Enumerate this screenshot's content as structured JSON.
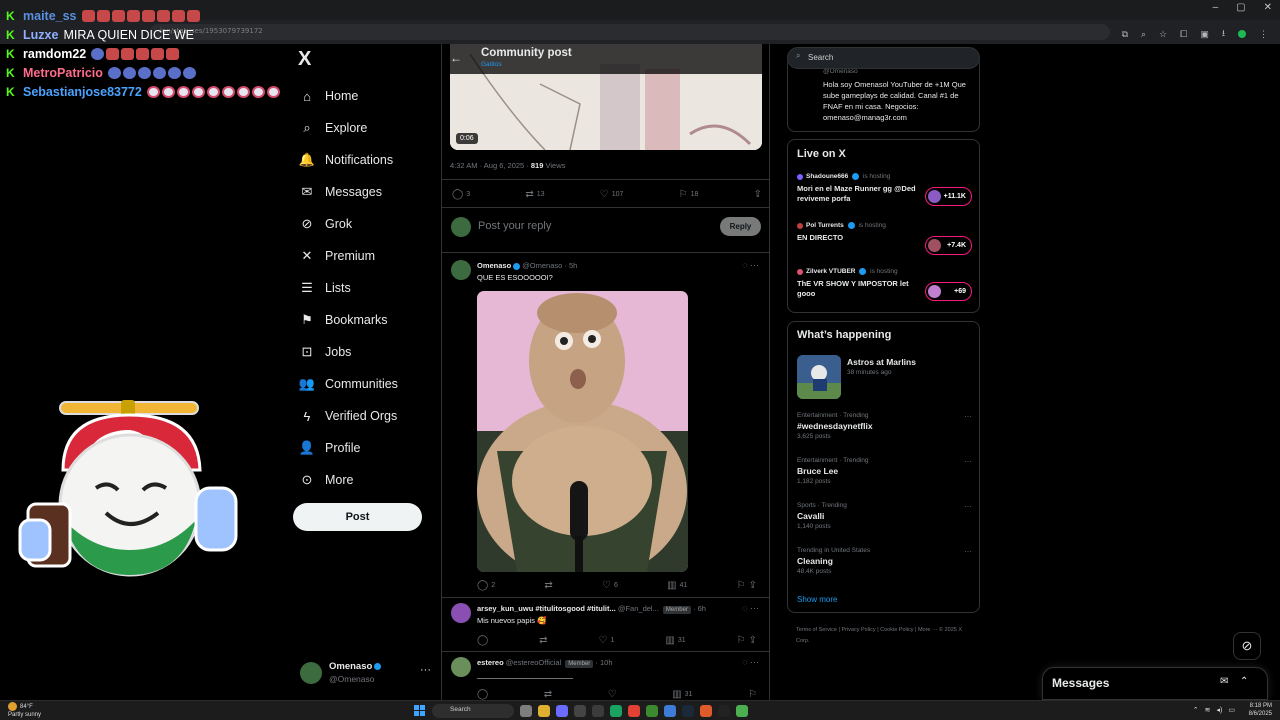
{
  "browser": {
    "address": "ion/statuses/1953079739172",
    "window_controls": [
      "–",
      "▢",
      "✕"
    ],
    "ext_icons": [
      "⧉",
      "⌕",
      "☆",
      "⧠",
      "▣",
      "⭳",
      "⋮"
    ]
  },
  "stream_chat": [
    {
      "name": "maite_ss",
      "name_color": "#5b8fe0",
      "message": "",
      "emotes": [
        "red",
        "red",
        "red",
        "red",
        "red",
        "red",
        "red",
        "red"
      ]
    },
    {
      "name": "Luzxe",
      "name_color": "#8fb0ff",
      "message": "MIRA QUIEN DICE WE",
      "emotes": []
    },
    {
      "name": "ramdom22",
      "name_color": "#ffffff",
      "message": "",
      "emotes": [
        "blue",
        "red",
        "red",
        "red",
        "red",
        "red"
      ]
    },
    {
      "name": "MetroPatricio",
      "name_color": "#ff6b8b",
      "message": "",
      "emotes": [
        "blue",
        "blue",
        "blue",
        "blue",
        "blue",
        "blue"
      ]
    },
    {
      "name": "Sebastianjose83772",
      "name_color": "#4aa3ff",
      "message": "",
      "emotes": [
        "pink",
        "pink",
        "pink",
        "pink",
        "pink",
        "pink",
        "pink",
        "pink",
        "pink"
      ]
    }
  ],
  "nav": {
    "logo": "X",
    "items": [
      {
        "label": "Home",
        "icon": "home-icon",
        "glyph": "⌂"
      },
      {
        "label": "Explore",
        "icon": "search-icon",
        "glyph": "⌕"
      },
      {
        "label": "Notifications",
        "icon": "bell-icon",
        "glyph": "🔔"
      },
      {
        "label": "Messages",
        "icon": "envelope-icon",
        "glyph": "✉"
      },
      {
        "label": "Grok",
        "icon": "grok-icon",
        "glyph": "⊘"
      },
      {
        "label": "Premium",
        "icon": "x-icon",
        "glyph": "✕"
      },
      {
        "label": "Lists",
        "icon": "list-icon",
        "glyph": "☰"
      },
      {
        "label": "Bookmarks",
        "icon": "bookmark-icon",
        "glyph": "⚑"
      },
      {
        "label": "Jobs",
        "icon": "briefcase-icon",
        "glyph": "⊡"
      },
      {
        "label": "Communities",
        "icon": "people-icon",
        "glyph": "👥"
      },
      {
        "label": "Verified Orgs",
        "icon": "lightning-icon",
        "glyph": "ϟ"
      },
      {
        "label": "Profile",
        "icon": "person-icon",
        "glyph": "👤"
      },
      {
        "label": "More",
        "icon": "more-circle-icon",
        "glyph": "⊙"
      }
    ],
    "post_button": "Post",
    "account": {
      "name": "Omenaso",
      "handle": "@Omenaso",
      "more": "···"
    }
  },
  "header": {
    "title": "Community post",
    "subtitle": "Gatitos",
    "back": "←"
  },
  "main_post": {
    "video_time": "0:06",
    "timestamp": "4:32 AM · Aug 6, 2025 · ",
    "views_count": "819",
    "views_label": " Views",
    "stats": {
      "replies": "3",
      "reposts": "13",
      "likes": "107",
      "bookmarks": "18"
    }
  },
  "reply_box": {
    "placeholder": "Post your reply",
    "button": "Reply"
  },
  "replies": [
    {
      "name": "Omenaso",
      "handle": "@Omenaso · 5h",
      "text": "QUE ES ESOOOOOI?",
      "stats": {
        "replies": "2",
        "reposts": "",
        "likes": "6",
        "views": "41"
      }
    },
    {
      "name": "arsey_kun_uwu #titulitosgood #titulit...",
      "handle": "@Fan_del...",
      "badge": "Member",
      "time": "· 6h",
      "text": "Mis nuevos papis 🥰",
      "stats": {
        "replies": "",
        "reposts": "",
        "likes": "1",
        "views": "31"
      }
    },
    {
      "name": "estereo",
      "handle": "@estereoOfficial",
      "badge": "Member",
      "time": "· 10h",
      "text": "_______________________",
      "stats": {
        "replies": "",
        "reposts": "",
        "likes": "",
        "views": "31"
      }
    }
  ],
  "sidebar": {
    "search_placeholder": "Search",
    "bio": {
      "handle": "@Omenaso",
      "text": "Hola soy Omenasol YouTuber de +1M Que sube gameplays de calidad. Canal #1 de FNAF en mi casa. Negocios: omenaso@manag3r.com"
    },
    "live": {
      "title": "Live on X",
      "items": [
        {
          "host": "Shadoune666",
          "hosting": "is hosting",
          "title": "Mori en el Maze Runner gg @Ded reviveme porfa",
          "count": "+11.1K"
        },
        {
          "host": "Pol Turrents",
          "hosting": "is hosting",
          "title": "EN DIRECTO",
          "count": "+7.4K"
        },
        {
          "host": "Zilverk VTUBER",
          "hosting": "is hosting",
          "title": "ThE VR SHOW Y IMPOSTOR let gooo",
          "count": "+69"
        }
      ]
    },
    "happening": {
      "title": "What’s happening",
      "featured": {
        "name": "Astros at Marlins",
        "time": "38 minutes ago"
      },
      "trends": [
        {
          "category": "Entertainment · Trending",
          "name": "#wednesdaynetflix",
          "count": "3,625 posts"
        },
        {
          "category": "Entertainment · Trending",
          "name": "Bruce Lee",
          "count": "1,182 posts"
        },
        {
          "category": "Sports · Trending",
          "name": "Cavalli",
          "count": "1,140 posts"
        },
        {
          "category": "Trending in United States",
          "name": "Cleaning",
          "count": "48.4K posts"
        }
      ],
      "show_more": "Show more"
    },
    "footer": "Terms of Service  |  Privacy Policy  |  Cookie Policy  |  More ···  © 2025 X Corp."
  },
  "messages_drawer": {
    "title": "Messages"
  },
  "taskbar": {
    "weather_temp": "84°F",
    "weather_desc": "Partly sunny",
    "search": "Search",
    "time": "8:18 PM",
    "date": "8/6/2025"
  },
  "colors": {
    "accent": "#1d9bf0",
    "live": "#f91880",
    "kick": "#53fc18"
  }
}
